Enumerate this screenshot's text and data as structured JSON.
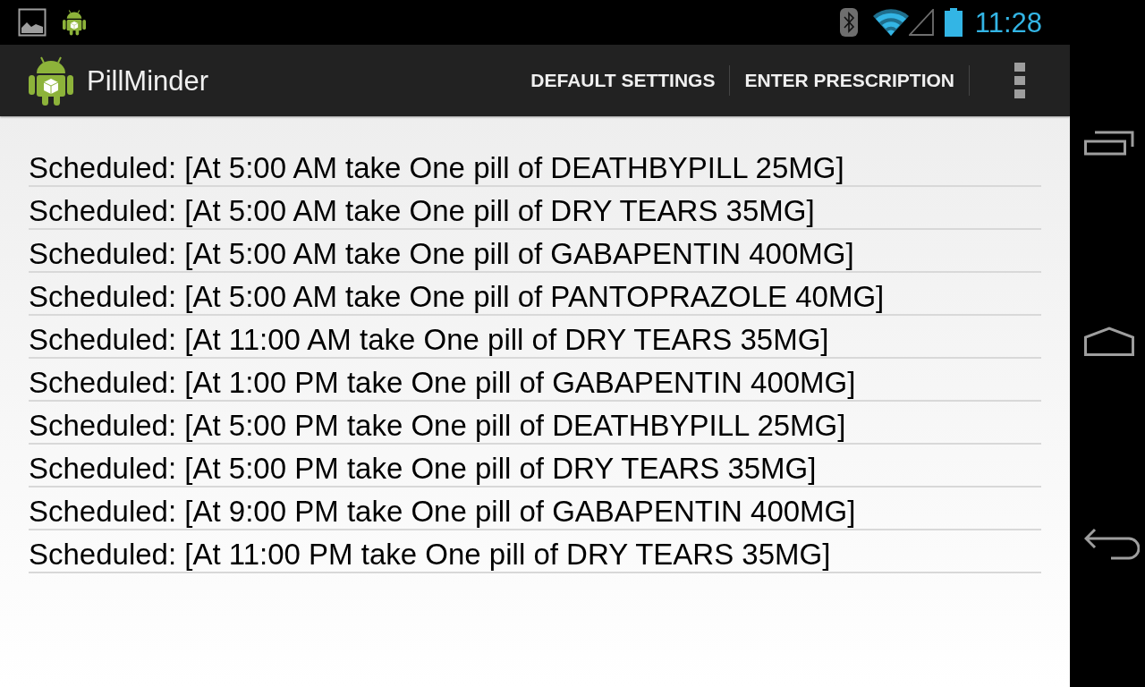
{
  "status_bar": {
    "time": "11:28"
  },
  "action_bar": {
    "title": "PillMinder",
    "actions": [
      "DEFAULT SETTINGS",
      "ENTER PRESCRIPTION"
    ]
  },
  "schedule": [
    "Scheduled: [At 5:00 AM take One pill of DEATHBYPILL 25MG]",
    "Scheduled: [At 5:00 AM take One pill of DRY TEARS 35MG]",
    "Scheduled: [At 5:00 AM take One pill of GABAPENTIN 400MG]",
    "Scheduled: [At 5:00 AM take One pill of PANTOPRAZOLE 40MG]",
    "Scheduled: [At 11:00 AM take One pill of DRY TEARS 35MG]",
    "Scheduled: [At 1:00 PM take One pill of GABAPENTIN 400MG]",
    "Scheduled: [At 5:00 PM take One pill of DEATHBYPILL 25MG]",
    "Scheduled: [At 5:00 PM take One pill of DRY TEARS 35MG]",
    "Scheduled: [At 9:00 PM take One pill of GABAPENTIN 400MG]",
    "Scheduled: [At 11:00 PM take One pill of DRY TEARS 35MG]"
  ]
}
